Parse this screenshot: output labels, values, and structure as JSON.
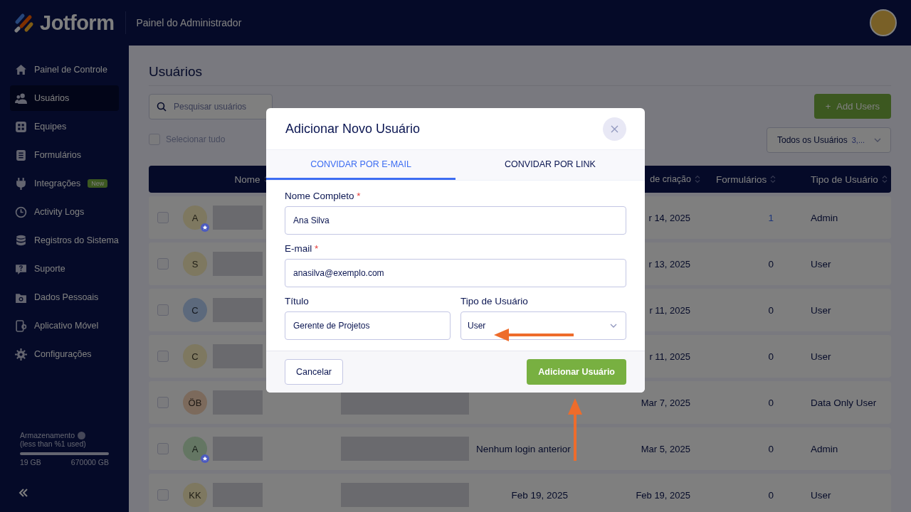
{
  "header": {
    "logo_text": "Jotform",
    "title": "Painel do Administrador"
  },
  "sidebar": {
    "items": [
      {
        "label": "Painel de Controle",
        "selected": false
      },
      {
        "label": "Usuários",
        "selected": true
      },
      {
        "label": "Equipes",
        "selected": false
      },
      {
        "label": "Formulários",
        "selected": false
      },
      {
        "label": "Integrações",
        "selected": false,
        "badge": "New"
      },
      {
        "label": "Activity Logs",
        "selected": false
      },
      {
        "label": "Registros do Sistema",
        "selected": false
      },
      {
        "label": "Suporte",
        "selected": false
      },
      {
        "label": "Dados Pessoais",
        "selected": false
      },
      {
        "label": "Aplicativo Móvel",
        "selected": false
      },
      {
        "label": "Configurações",
        "selected": false
      }
    ],
    "storage": {
      "title": "Armazenamento",
      "note": "(less than %1 used)",
      "used": "19 GB",
      "total": "670000 GB"
    }
  },
  "page": {
    "title": "Usuários",
    "search": {
      "placeholder": "Pesquisar usuários"
    },
    "select_all": {
      "label": "Selecionar tudo",
      "checked": false
    },
    "add_button": "Add Users",
    "add_icon": "+",
    "filter": {
      "label": "Todos os Usuários",
      "count": "3,..."
    }
  },
  "table": {
    "columns": [
      {
        "label": "Nome"
      },
      {
        "label": "de criação"
      },
      {
        "label": "Formulários"
      },
      {
        "label": "Tipo de Usuário"
      }
    ],
    "rows": [
      {
        "checked": false,
        "initials": "A",
        "color": "#7e7860",
        "admin_badge": true,
        "created": "r 14, 2025",
        "forms": "1",
        "forms_link": true,
        "type": "Admin"
      },
      {
        "checked": false,
        "initials": "S",
        "color": "#7e7860",
        "admin_badge": false,
        "created": "r 13, 2025",
        "forms": "0",
        "forms_link": false,
        "type": "User"
      },
      {
        "checked": false,
        "initials": "C",
        "color": "#5c697c",
        "admin_badge": false,
        "created": "r 11, 2025",
        "forms": "0",
        "forms_link": false,
        "type": "User"
      },
      {
        "checked": false,
        "initials": "C",
        "color": "#7e7860",
        "admin_badge": false,
        "created": "r 11, 2025",
        "forms": "0",
        "forms_link": false,
        "type": "User"
      },
      {
        "checked": false,
        "initials": "ÖB",
        "color": "#7c6a5c",
        "admin_badge": false,
        "created": "Mar 7, 2025",
        "forms": "0",
        "forms_link": false,
        "type": "Data Only User"
      },
      {
        "checked": false,
        "initials": "A",
        "color": "#647663",
        "admin_badge": true,
        "last_login": "Nenhum login anterior",
        "created": "Mar 5, 2025",
        "forms": "0",
        "forms_link": false,
        "type": "Admin"
      },
      {
        "checked": false,
        "initials": "KK",
        "color": "#7e7860",
        "admin_badge": false,
        "last_login": "Feb 19, 2025",
        "created": "Feb 19, 2025",
        "forms": "0",
        "forms_link": false,
        "type": "User"
      }
    ]
  },
  "modal": {
    "title": "Adicionar Novo Usuário",
    "tabs": [
      {
        "label": "CONVIDAR POR E-MAIL",
        "selected": true
      },
      {
        "label": "CONVIDAR POR LINK",
        "selected": false
      }
    ],
    "fields": [
      {
        "kind": "text",
        "label": "Nome Completo",
        "required_mark": "*",
        "value": "Ana Silva"
      },
      {
        "kind": "text",
        "label": "E-mail",
        "required_mark": "*",
        "value": "anasilva@exemplo.com"
      }
    ],
    "field_row": [
      {
        "kind": "text",
        "label": "Título",
        "value": "Gerente de Projetos"
      },
      {
        "kind": "select",
        "label": "Tipo de Usuário",
        "value": "User"
      }
    ],
    "cancel_button": "Cancelar",
    "submit_button": "Adicionar Usuário"
  }
}
